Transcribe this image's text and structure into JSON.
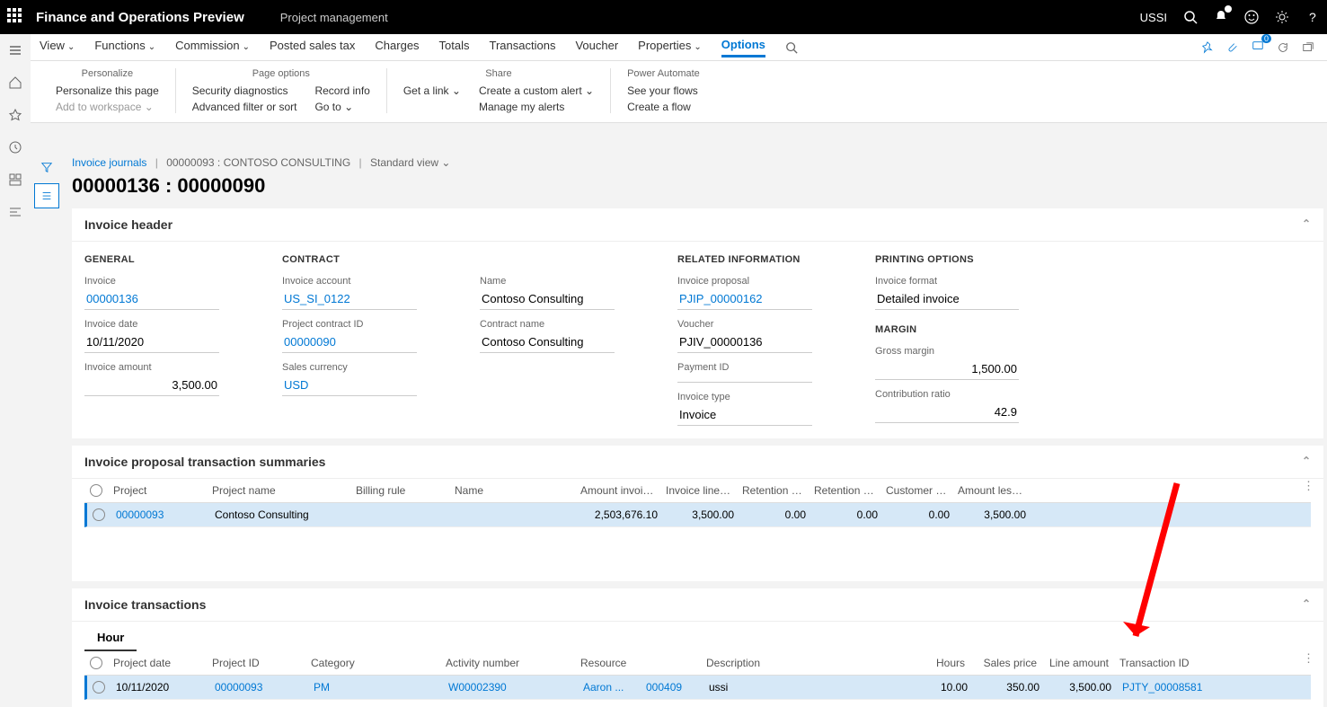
{
  "topbar": {
    "title": "Finance and Operations Preview",
    "module": "Project management",
    "user": "USSI"
  },
  "actionbar": {
    "tabs": [
      "View",
      "Functions",
      "Commission",
      "Posted sales tax",
      "Charges",
      "Totals",
      "Transactions",
      "Voucher",
      "Properties",
      "Options"
    ]
  },
  "ribbon": {
    "personalize": {
      "title": "Personalize",
      "items": [
        "Personalize this page",
        "Add to workspace"
      ]
    },
    "pageoptions": {
      "title": "Page options",
      "col1": [
        "Security diagnostics",
        "Advanced filter or sort"
      ],
      "col2": [
        "Record info",
        "Go to"
      ]
    },
    "share": {
      "title": "Share",
      "col1": [
        "Get a link"
      ],
      "col2": [
        "Create a custom alert",
        "Manage my alerts"
      ]
    },
    "power": {
      "title": "Power Automate",
      "items": [
        "See your flows",
        "Create a flow"
      ]
    }
  },
  "breadcrumb": {
    "link": "Invoice journals",
    "text": "00000093 : CONTOSO CONSULTING",
    "view": "Standard view"
  },
  "pageTitle": "00000136 : 00000090",
  "header": {
    "title": "Invoice header",
    "general": {
      "hd": "GENERAL",
      "invoice_lbl": "Invoice",
      "invoice": "00000136",
      "date_lbl": "Invoice date",
      "date": "10/11/2020",
      "amt_lbl": "Invoice amount",
      "amt": "3,500.00"
    },
    "contract": {
      "hd": "CONTRACT",
      "acct_lbl": "Invoice account",
      "acct": "US_SI_0122",
      "pcid_lbl": "Project contract ID",
      "pcid": "00000090",
      "cur_lbl": "Sales currency",
      "cur": "USD",
      "name_lbl": "Name",
      "name": "Contoso Consulting",
      "cname_lbl": "Contract name",
      "cname": "Contoso Consulting"
    },
    "related": {
      "hd": "RELATED INFORMATION",
      "prop_lbl": "Invoice proposal",
      "prop": "PJIP_00000162",
      "vouch_lbl": "Voucher",
      "vouch": "PJIV_00000136",
      "pay_lbl": "Payment ID",
      "pay": "",
      "type_lbl": "Invoice type",
      "type": "Invoice"
    },
    "printing": {
      "hd": "PRINTING OPTIONS",
      "fmt_lbl": "Invoice format",
      "fmt": "Detailed invoice"
    },
    "margin": {
      "hd": "MARGIN",
      "gm_lbl": "Gross margin",
      "gm": "1,500.00",
      "cr_lbl": "Contribution ratio",
      "cr": "42.9"
    }
  },
  "summaries": {
    "title": "Invoice proposal transaction summaries",
    "cols": [
      "Project",
      "Project name",
      "Billing rule",
      "Name",
      "Amount invoic...",
      "Invoice line am...",
      "Retention rele...",
      "Retention perc...",
      "Customer retai...",
      "Amount less re..."
    ],
    "row": {
      "project": "00000093",
      "pname": "Contoso Consulting",
      "brule": "",
      "name": "",
      "amt_inv": "2,503,676.10",
      "line_amt": "3,500.00",
      "ret_rel": "0.00",
      "ret_pct": "0.00",
      "cust_ret": "0.00",
      "amt_less": "3,500.00"
    }
  },
  "transactions": {
    "title": "Invoice transactions",
    "subtab": "Hour",
    "cols": [
      "Project date",
      "Project ID",
      "Category",
      "Activity number",
      "Resource",
      "",
      "Description",
      "Hours",
      "Sales price",
      "Line amount",
      "Transaction ID"
    ],
    "row": {
      "date": "10/11/2020",
      "pid": "00000093",
      "cat": "PM",
      "act": "W00002390",
      "res1": "Aaron ...",
      "res2": "000409",
      "desc": "ussi",
      "hours": "10.00",
      "price": "350.00",
      "line": "3,500.00",
      "txid": "PJTY_00008581"
    }
  }
}
